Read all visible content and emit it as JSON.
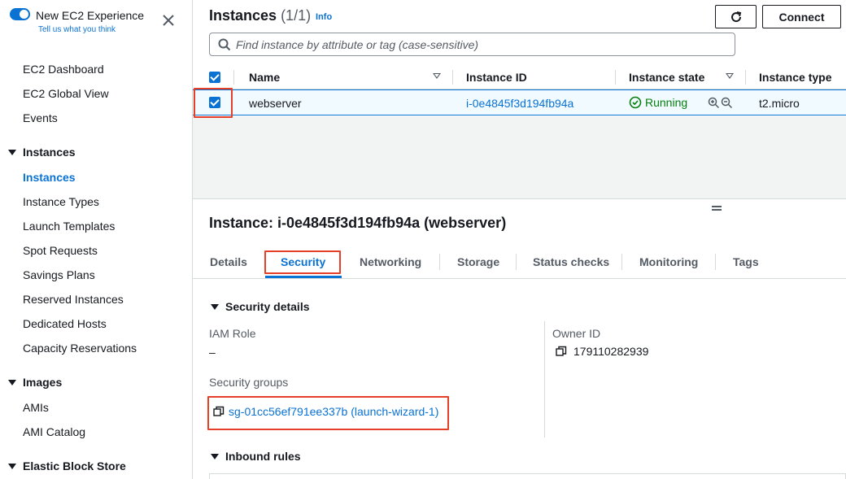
{
  "sidebar": {
    "experience_title": "New EC2 Experience",
    "experience_sub": "Tell us what you think",
    "items": [
      {
        "label": "EC2 Dashboard"
      },
      {
        "label": "EC2 Global View"
      },
      {
        "label": "Events"
      }
    ],
    "sections": [
      {
        "label": "Instances"
      },
      {
        "label": "Images"
      },
      {
        "label": "Elastic Block Store"
      }
    ],
    "instances_items": [
      {
        "label": "Instances"
      },
      {
        "label": "Instance Types"
      },
      {
        "label": "Launch Templates"
      },
      {
        "label": "Spot Requests"
      },
      {
        "label": "Savings Plans"
      },
      {
        "label": "Reserved Instances"
      },
      {
        "label": "Dedicated Hosts"
      },
      {
        "label": "Capacity Reservations"
      }
    ],
    "images_items": [
      {
        "label": "AMIs"
      },
      {
        "label": "AMI Catalog"
      }
    ]
  },
  "instances_panel": {
    "title": "Instances",
    "count": "(1/1)",
    "info": "Info",
    "connect_label": "Connect",
    "search_placeholder": "Find instance by attribute or tag (case-sensitive)",
    "columns": [
      "Name",
      "Instance ID",
      "Instance state",
      "Instance type"
    ],
    "rows": [
      {
        "name": "webserver",
        "instance_id": "i-0e4845f3d194fb94a",
        "state": "Running",
        "type": "t2.micro"
      }
    ]
  },
  "details": {
    "title": "Instance: i-0e4845f3d194fb94a (webserver)",
    "tabs": [
      "Details",
      "Security",
      "Networking",
      "Storage",
      "Status checks",
      "Monitoring",
      "Tags"
    ],
    "active_tab": "Security",
    "security_details_heading": "Security details",
    "iam_role_label": "IAM Role",
    "iam_role_value": "–",
    "owner_id_label": "Owner ID",
    "owner_id_value": "179110282939",
    "security_groups_label": "Security groups",
    "security_group_value": "sg-01cc56ef791ee337b (launch-wizard-1)",
    "inbound_rules_heading": "Inbound rules"
  },
  "colors": {
    "accent": "#0972d3",
    "running": "#037f0c",
    "highlight": "#e53f27"
  }
}
